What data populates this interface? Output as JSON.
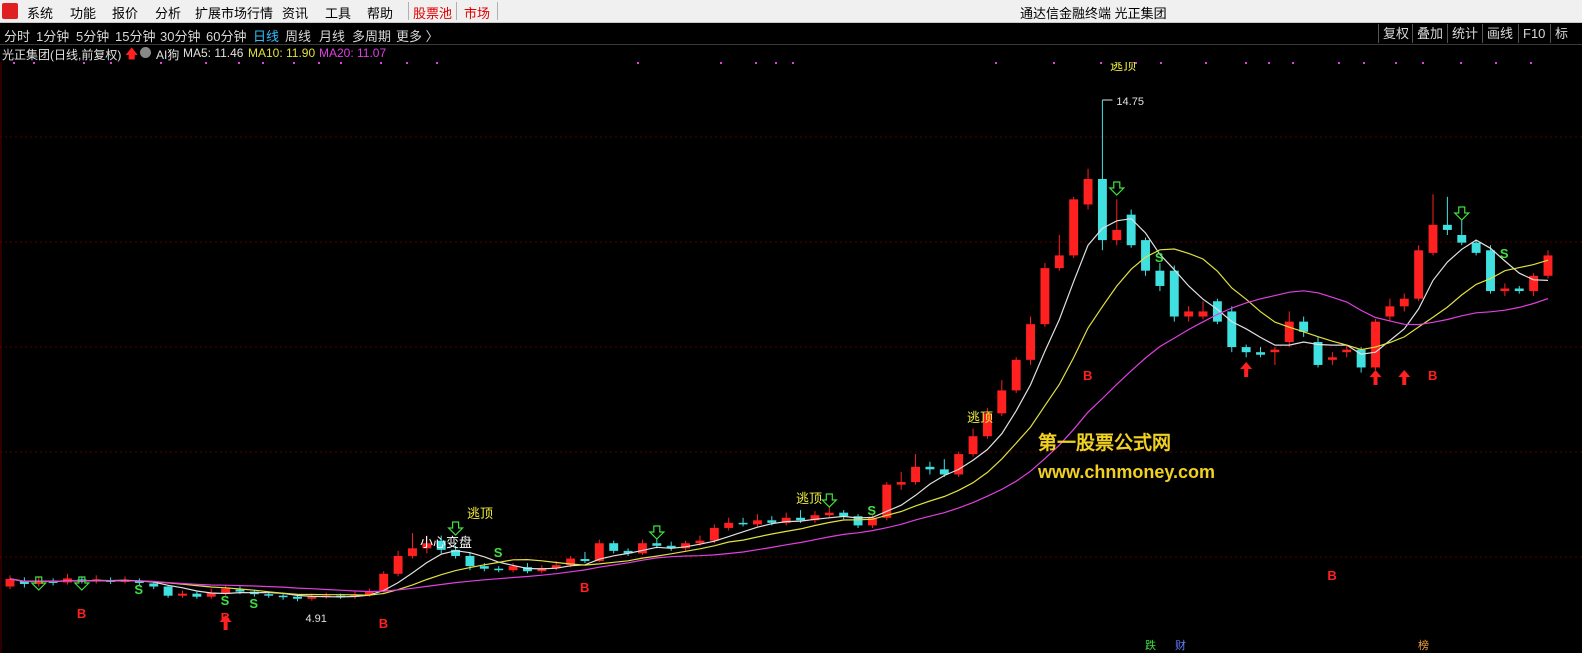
{
  "menubar": {
    "items": [
      "系统",
      "功能",
      "报价",
      "分析",
      "扩展市场行情",
      "资讯",
      "工具",
      "帮助",
      "股票池",
      "市场"
    ],
    "title": "通达信金融终端  光正集团"
  },
  "toolbar": {
    "periods": [
      "分时",
      "1分钟",
      "5分钟",
      "15分钟",
      "30分钟",
      "60分钟",
      "日线",
      "周线",
      "月线",
      "多周期",
      "更多 〉"
    ],
    "active_period": "日线",
    "right_buttons": [
      "复权",
      "叠加",
      "统计",
      "画线",
      "F10",
      "标"
    ]
  },
  "infobar": {
    "stock": "光正集团(日线,前复权)",
    "indicator": "AI狗",
    "ma5": "MA5: 11.46",
    "ma10": "MA10: 11.90",
    "ma20": "MA20: 11.07"
  },
  "chart_labels": {
    "high_price": "14.75",
    "low_price": "4.91",
    "caution": "小心变盘",
    "escape_1": "逃顶",
    "escape_2": "逃顶",
    "escape_3": "逃顶",
    "escape_top_cut": "逃顶",
    "bottom_markers": [
      "跌",
      "财",
      "榜"
    ]
  },
  "watermark": {
    "line1": "第一股票公式网",
    "line2": "www.chnmoney.com"
  },
  "colors": {
    "up": "#ff2020",
    "down": "#40e0e0",
    "ma5": "#e0e0e0",
    "ma10": "#e0e040",
    "ma20": "#e040e0",
    "buy": "#ff2020",
    "sell": "#40e040",
    "watermark": "#f0d020"
  },
  "chart_data": {
    "type": "candlestick",
    "y_unit": "price",
    "high": 14.75,
    "low": 4.91,
    "candles": [
      [
        5.2,
        5.35,
        5.42,
        5.15
      ],
      [
        5.3,
        5.25,
        5.38,
        5.18
      ],
      [
        5.25,
        5.32,
        5.4,
        5.2
      ],
      [
        5.3,
        5.28,
        5.36,
        5.22
      ],
      [
        5.28,
        5.36,
        5.45,
        5.24
      ],
      [
        5.34,
        5.3,
        5.4,
        5.26
      ],
      [
        5.3,
        5.34,
        5.42,
        5.26
      ],
      [
        5.32,
        5.3,
        5.38,
        5.25
      ],
      [
        5.3,
        5.32,
        5.4,
        5.26
      ],
      [
        5.3,
        5.28,
        5.36,
        5.22
      ],
      [
        5.26,
        5.2,
        5.3,
        5.15
      ],
      [
        5.2,
        5.02,
        5.22,
        4.98
      ],
      [
        5.02,
        5.06,
        5.12,
        4.98
      ],
      [
        5.06,
        5.0,
        5.1,
        4.96
      ],
      [
        5.0,
        5.08,
        5.16,
        4.96
      ],
      [
        5.06,
        5.16,
        5.22,
        5.02
      ],
      [
        5.14,
        5.1,
        5.2,
        5.05
      ],
      [
        5.1,
        5.05,
        5.14,
        5.0
      ],
      [
        5.05,
        5.02,
        5.1,
        4.98
      ],
      [
        5.02,
        5.0,
        5.06,
        4.94
      ],
      [
        5.0,
        4.96,
        5.04,
        4.91
      ],
      [
        4.96,
        5.0,
        5.06,
        4.92
      ],
      [
        5.0,
        5.02,
        5.08,
        4.96
      ],
      [
        5.02,
        5.0,
        5.06,
        4.96
      ],
      [
        5.0,
        5.04,
        5.1,
        4.96
      ],
      [
        5.04,
        5.1,
        5.16,
        5.0
      ],
      [
        5.1,
        5.45,
        5.5,
        5.08
      ],
      [
        5.45,
        5.8,
        5.9,
        5.4
      ],
      [
        5.8,
        5.95,
        6.25,
        5.75
      ],
      [
        5.95,
        6.05,
        6.2,
        5.85
      ],
      [
        6.1,
        5.92,
        6.2,
        5.85
      ],
      [
        5.92,
        5.8,
        6.0,
        5.75
      ],
      [
        5.8,
        5.6,
        5.88,
        5.52
      ],
      [
        5.6,
        5.55,
        5.66,
        5.5
      ],
      [
        5.55,
        5.52,
        5.6,
        5.48
      ],
      [
        5.52,
        5.6,
        5.66,
        5.48
      ],
      [
        5.58,
        5.5,
        5.66,
        5.46
      ],
      [
        5.5,
        5.56,
        5.62,
        5.46
      ],
      [
        5.56,
        5.62,
        5.7,
        5.52
      ],
      [
        5.62,
        5.75,
        5.8,
        5.58
      ],
      [
        5.74,
        5.7,
        5.88,
        5.66
      ],
      [
        5.7,
        6.05,
        6.12,
        5.68
      ],
      [
        6.05,
        5.9,
        6.1,
        5.85
      ],
      [
        5.9,
        5.85,
        5.95,
        5.8
      ],
      [
        5.85,
        6.05,
        6.12,
        5.82
      ],
      [
        6.05,
        6.0,
        6.15,
        5.95
      ],
      [
        6.0,
        5.95,
        6.08,
        5.9
      ],
      [
        5.95,
        6.05,
        6.1,
        5.9
      ],
      [
        6.05,
        6.1,
        6.2,
        6.0
      ],
      [
        6.1,
        6.35,
        6.42,
        6.05
      ],
      [
        6.35,
        6.45,
        6.55,
        6.3
      ],
      [
        6.45,
        6.42,
        6.55,
        6.38
      ],
      [
        6.42,
        6.5,
        6.62,
        6.38
      ],
      [
        6.5,
        6.45,
        6.58,
        6.4
      ],
      [
        6.45,
        6.55,
        6.65,
        6.4
      ],
      [
        6.55,
        6.5,
        6.7,
        6.45
      ],
      [
        6.5,
        6.6,
        6.68,
        6.45
      ],
      [
        6.6,
        6.65,
        6.75,
        6.55
      ],
      [
        6.65,
        6.58,
        6.7,
        6.52
      ],
      [
        6.58,
        6.4,
        6.62,
        6.35
      ],
      [
        6.4,
        6.55,
        6.6,
        6.35
      ],
      [
        6.55,
        7.2,
        7.25,
        6.5
      ],
      [
        7.2,
        7.25,
        7.45,
        7.1
      ],
      [
        7.25,
        7.55,
        7.8,
        7.2
      ],
      [
        7.55,
        7.5,
        7.65,
        7.4
      ],
      [
        7.5,
        7.4,
        7.7,
        7.35
      ],
      [
        7.4,
        7.8,
        7.85,
        7.35
      ],
      [
        7.8,
        8.15,
        8.3,
        7.75
      ],
      [
        8.15,
        8.6,
        8.7,
        8.1
      ],
      [
        8.6,
        9.05,
        9.25,
        8.55
      ],
      [
        9.05,
        9.65,
        9.7,
        9.0
      ],
      [
        9.65,
        10.35,
        10.5,
        9.55
      ],
      [
        10.35,
        11.45,
        11.55,
        10.3
      ],
      [
        11.45,
        11.7,
        12.1,
        11.4
      ],
      [
        11.7,
        12.8,
        12.85,
        11.65
      ],
      [
        12.7,
        13.2,
        13.4,
        12.6
      ],
      [
        13.2,
        12.0,
        14.75,
        11.8
      ],
      [
        12.0,
        12.2,
        12.8,
        11.9
      ],
      [
        12.5,
        11.9,
        12.6,
        11.85
      ],
      [
        12.0,
        11.4,
        12.05,
        11.3
      ],
      [
        11.4,
        11.1,
        11.55,
        11.0
      ],
      [
        11.4,
        10.5,
        11.5,
        10.4
      ],
      [
        10.5,
        10.6,
        10.7,
        10.4
      ],
      [
        10.5,
        10.6,
        10.8,
        10.45
      ],
      [
        10.8,
        10.4,
        10.85,
        10.35
      ],
      [
        10.6,
        9.9,
        10.7,
        9.8
      ],
      [
        9.9,
        9.8,
        9.95,
        9.7
      ],
      [
        9.8,
        9.75,
        9.9,
        9.7
      ],
      [
        9.8,
        9.85,
        9.9,
        9.55
      ],
      [
        10.0,
        10.4,
        10.6,
        9.9
      ],
      [
        10.4,
        10.2,
        10.5,
        10.1
      ],
      [
        10.0,
        9.55,
        10.1,
        9.5
      ],
      [
        9.65,
        9.7,
        9.8,
        9.55
      ],
      [
        9.8,
        9.85,
        9.95,
        9.7
      ],
      [
        9.85,
        9.5,
        9.9,
        9.4
      ],
      [
        9.5,
        10.4,
        10.45,
        9.45
      ],
      [
        10.5,
        10.7,
        10.85,
        10.4
      ],
      [
        10.7,
        10.85,
        10.95,
        10.6
      ],
      [
        10.85,
        11.8,
        11.9,
        10.8
      ],
      [
        11.75,
        12.3,
        12.9,
        11.7
      ],
      [
        12.3,
        12.2,
        12.85,
        12.1
      ],
      [
        12.1,
        11.95,
        12.4,
        11.9
      ],
      [
        11.95,
        11.75,
        12.0,
        11.7
      ],
      [
        11.8,
        11.0,
        11.9,
        10.95
      ],
      [
        11.0,
        11.05,
        11.15,
        10.9
      ],
      [
        11.05,
        11.0,
        11.1,
        10.95
      ],
      [
        11.0,
        11.3,
        11.35,
        10.9
      ],
      [
        11.3,
        11.7,
        11.8,
        11.25
      ]
    ],
    "ma5_label": "MA5: 11.46",
    "ma10_label": "MA10: 11.90",
    "ma20_label": "MA20: 11.07"
  }
}
